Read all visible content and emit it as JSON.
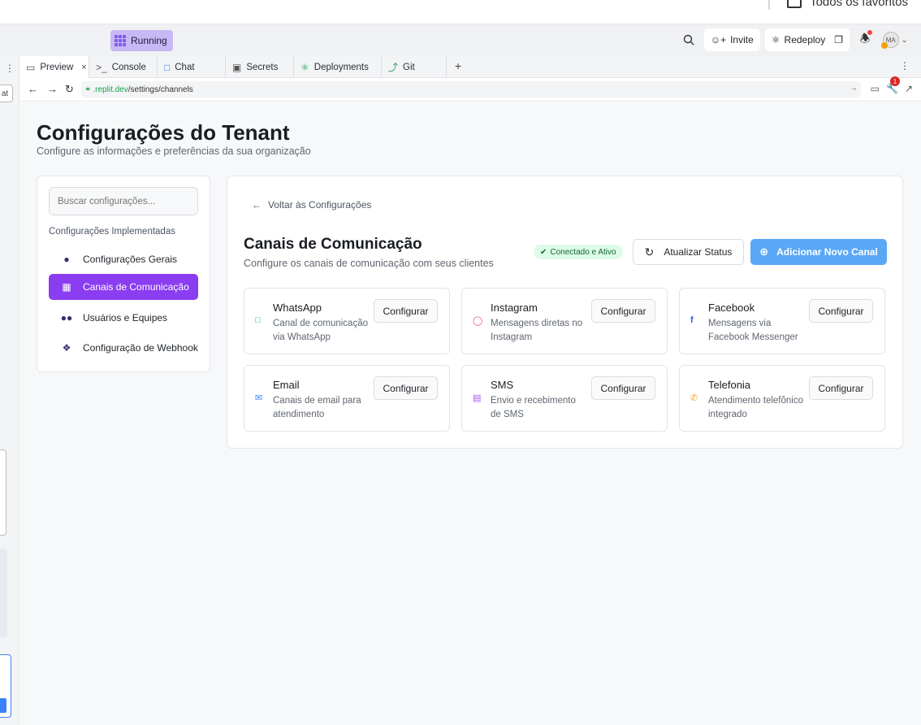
{
  "browser": {
    "favorites_label": "Todos os favoritos"
  },
  "replit": {
    "running_label": "Running",
    "invite_label": "Invite",
    "redeploy_label": "Redeploy",
    "avatar_initials": "MA",
    "notification_count": "1",
    "sliver_chip": "at"
  },
  "tabs": [
    {
      "label": "Preview",
      "icon": "monitor-icon",
      "active": true
    },
    {
      "label": "Console",
      "icon": "terminal-icon"
    },
    {
      "label": "Chat",
      "icon": "chat-icon"
    },
    {
      "label": "Secrets",
      "icon": "lock-icon"
    },
    {
      "label": "Deployments",
      "icon": "deploy-icon"
    },
    {
      "label": "Git",
      "icon": "git-icon"
    }
  ],
  "address": {
    "host": ".replit.dev",
    "path": "/settings/channels"
  },
  "page": {
    "title": "Configurações do Tenant",
    "subtitle": "Configure as informações e preferências da sua organização"
  },
  "sidebar": {
    "search_placeholder": "Buscar configurações...",
    "heading": "Configurações Implementadas",
    "items": [
      {
        "label": "Configurações Gerais",
        "icon": "user-icon"
      },
      {
        "label": "Canais de Comunicação",
        "icon": "building-icon",
        "active": true
      },
      {
        "label": "Usuários e Equipes",
        "icon": "users-icon"
      },
      {
        "label": "Configuração de Webhook",
        "icon": "plug-icon"
      }
    ]
  },
  "panel": {
    "back_label": "Voltar às Configurações",
    "title": "Canais de Comunicação",
    "subtitle": "Configure os canais de comunicação com seus clientes",
    "status_badge": "Conectado e Ativo",
    "refresh_label": "Atualizar Status",
    "add_label": "Adicionar Novo Canal",
    "channels": [
      {
        "name": "WhatsApp",
        "desc": "Canal de comunicação via WhatsApp",
        "icon": "message-icon",
        "color": "#22c55e",
        "button": "Configurar"
      },
      {
        "name": "Instagram",
        "desc": "Mensagens diretas no Instagram",
        "icon": "instagram-icon",
        "color": "#ec4899",
        "button": "Configurar"
      },
      {
        "name": "Facebook",
        "desc": "Mensagens via Facebook Messenger",
        "icon": "facebook-icon",
        "color": "#2563eb",
        "button": "Configurar"
      },
      {
        "name": "Email",
        "desc": "Canais de email para atendimento",
        "icon": "mail-icon",
        "color": "#3b82f6",
        "button": "Configurar"
      },
      {
        "name": "SMS",
        "desc": "Envio e recebimento de SMS",
        "icon": "sms-icon",
        "color": "#a855f7",
        "button": "Configurar"
      },
      {
        "name": "Telefonia",
        "desc": "Atendimento telefônico integrado",
        "icon": "phone-icon",
        "color": "#f59e0b",
        "button": "Configurar"
      }
    ]
  },
  "colors": {
    "accent": "#8b3df2",
    "primary_button": "#5aa8f5",
    "status_green": "#dcfce7"
  }
}
